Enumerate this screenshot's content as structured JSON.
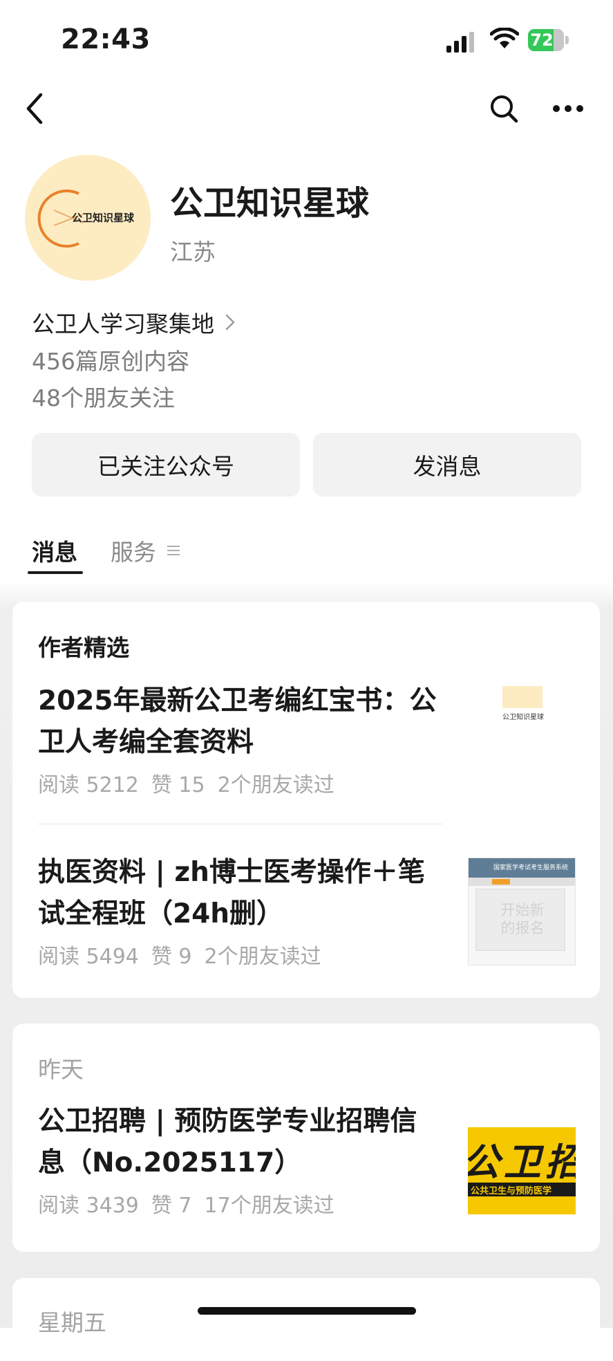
{
  "status_bar": {
    "time": "22:43",
    "battery_percent": "72",
    "battery_level": 0.72,
    "battery_color": "#34c759"
  },
  "nav": {
    "back_icon": "chevron-left-icon",
    "search_icon": "search-icon",
    "more_icon": "more-dots-icon"
  },
  "profile": {
    "avatar_text": "公卫知识星球",
    "name": "公卫知识星球",
    "region": "江苏",
    "intro": "公卫人学习聚集地",
    "original_count": "456篇原创内容",
    "friends_following": "48个朋友关注",
    "avatar_bg": "#fdecc2",
    "accent": "#e8822a"
  },
  "actions": {
    "followed_label": "已关注公众号",
    "message_label": "发消息"
  },
  "tabs": {
    "messages": "消息",
    "services": "服务"
  },
  "feed": {
    "picks": {
      "label": "作者精选",
      "articles": [
        {
          "title": "2025年最新公卫考编红宝书：公卫人考编全套资料",
          "reads": "阅读 5212",
          "likes": "赞 15",
          "friends": "2个朋友读过",
          "thumb_text": "公卫知识星球"
        },
        {
          "title": "执医资料 | zh博士医考操作＋笔试全程班（24h删）",
          "reads": "阅读 5494",
          "likes": "赞 9",
          "friends": "2个朋友读过",
          "thumb_header": "国家医学考试考生服务系统",
          "thumb_text": "开始新的报名"
        }
      ]
    },
    "yesterday": {
      "label": "昨天",
      "articles": [
        {
          "title": "公卫招聘 | 预防医学专业招聘信息（No.2025117）",
          "reads": "阅读 3439",
          "likes": "赞 7",
          "friends": "17个朋友读过",
          "thumb_big": "公卫招聘",
          "thumb_strip": "公共卫生与预防医学"
        }
      ]
    },
    "friday": {
      "label": "星期五"
    }
  }
}
